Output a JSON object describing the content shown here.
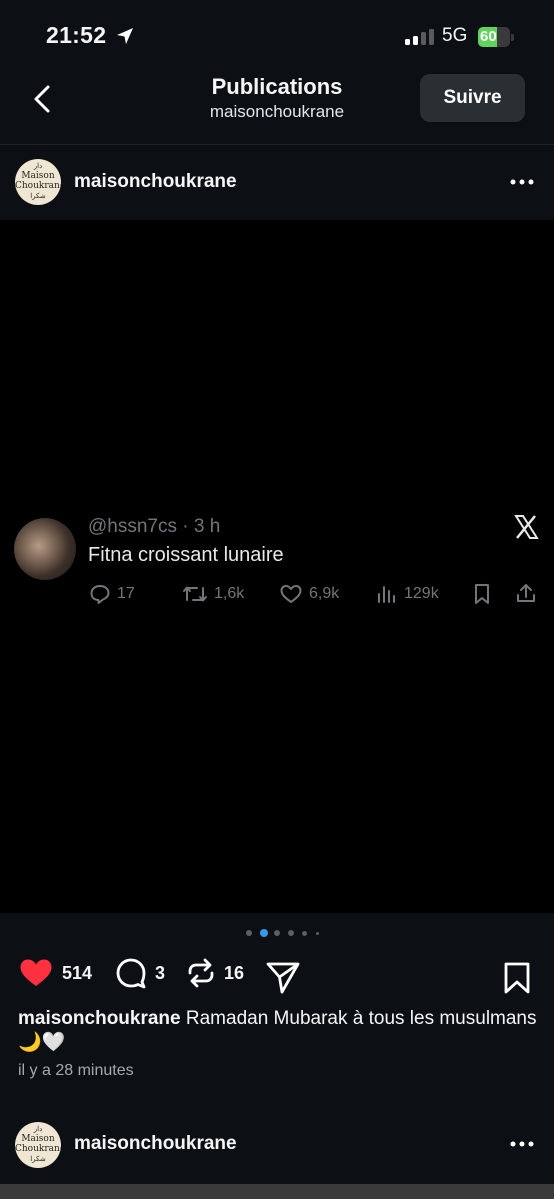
{
  "status_bar": {
    "time": "21:52",
    "network": "5G",
    "battery": "60",
    "battery_level": 0.6
  },
  "header": {
    "title": "Publications",
    "subtitle": "maisonchoukrane",
    "follow_label": "Suivre"
  },
  "post": {
    "username": "maisonchoukrane",
    "avatar_text": {
      "top": "دار",
      "line1": "Maison",
      "line2": "Choukrane",
      "bottom": "شكرا"
    },
    "tweet": {
      "handle": "@hssn7cs",
      "time": "· 3 h",
      "text": "Fitna croissant lunaire",
      "replies": "17",
      "retweets": "1,6k",
      "likes": "6,9k",
      "views": "129k"
    },
    "carousel": {
      "count": 6,
      "active_index": 1
    },
    "likes": "514",
    "comments": "3",
    "reposts": "16",
    "caption_user": "maisonchoukrane",
    "caption_text": " Ramadan Mubarak à tous les musulmans 🌙🤍",
    "time_ago": "il y a 28 minutes"
  },
  "next_post": {
    "username": "maisonchoukrane"
  }
}
